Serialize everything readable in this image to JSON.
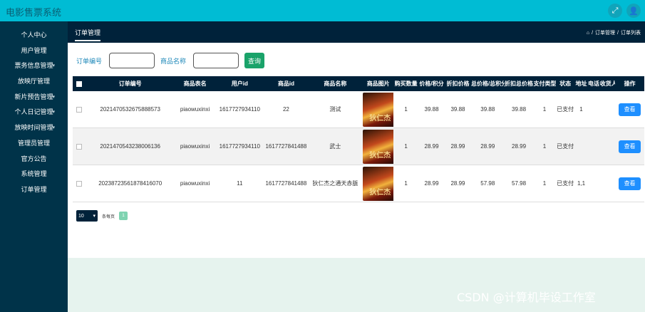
{
  "app": {
    "title": "电影售票系统"
  },
  "top_icons": [
    {
      "icon": "fullscreen-icon",
      "glyph": "⤢"
    },
    {
      "icon": "user-icon",
      "glyph": "👤"
    }
  ],
  "sidebar": {
    "items": [
      {
        "label": "个人中心",
        "has_caret": false
      },
      {
        "label": "用户管理",
        "has_caret": false
      },
      {
        "label": "票务信息管理",
        "has_caret": true
      },
      {
        "label": "放映厅管理",
        "has_caret": false
      },
      {
        "label": "新片预告管理",
        "has_caret": true
      },
      {
        "label": "个人日记管理",
        "has_caret": true
      },
      {
        "label": "放映时间管理",
        "has_caret": true
      },
      {
        "label": "管理员管理",
        "has_caret": false
      },
      {
        "label": "官方公告",
        "has_caret": false
      },
      {
        "label": "系统管理",
        "has_caret": false
      },
      {
        "label": "订单管理",
        "has_caret": false
      }
    ]
  },
  "header": {
    "tab": "订单管理",
    "breadcrumb": {
      "sep1": "/",
      "item1": "订单管理",
      "sep2": "/",
      "item2": "订单列表"
    }
  },
  "search": {
    "order_no_label": "订单编号",
    "product_name_label": "商品名称",
    "button": "查询"
  },
  "table": {
    "columns": [
      "订单编号",
      "商品表名",
      "用户id",
      "商品id",
      "商品名称",
      "商品图片",
      "购买数量",
      "价格/积分",
      "折扣价格",
      "总价格/总积分",
      "折扣总价格",
      "支付类型",
      "状态",
      "地址",
      "电话",
      "收货人",
      "操作"
    ],
    "rows": [
      {
        "order_no": "2021470532675888573",
        "table_name": "piaowuxinxi",
        "user_id": "1617727934110",
        "product_id": "22",
        "product_name": "测试",
        "poster_text": "狄仁杰",
        "qty": "1",
        "price": "39.88",
        "discount_price": "39.88",
        "total": "39.88",
        "discount_total": "39.88",
        "pay_type": "1",
        "status": "已支付",
        "address": "1",
        "phone": "",
        "receiver": "",
        "action": "查看"
      },
      {
        "order_no": "2021470543238006136",
        "table_name": "piaowuxinxi",
        "user_id": "1617727934110",
        "product_id": "1617727841488",
        "product_name": "武士",
        "poster_text": "狄仁杰",
        "qty": "1",
        "price": "28.99",
        "discount_price": "28.99",
        "total": "28.99",
        "discount_total": "28.99",
        "pay_type": "1",
        "status": "已支付",
        "address": "",
        "phone": "",
        "receiver": "",
        "action": "查看"
      },
      {
        "order_no": "20238723561878416070",
        "table_name": "piaowuxinxi",
        "user_id": "11",
        "product_id": "1617727841488",
        "product_name": "狄仁杰之通天赤脈",
        "poster_text": "狄仁杰",
        "qty": "1",
        "price": "28.99",
        "discount_price": "28.99",
        "total": "57.98",
        "discount_total": "57.98",
        "pay_type": "1",
        "status": "已支付",
        "address": "1,1",
        "phone": "",
        "receiver": "",
        "action": "查看"
      }
    ]
  },
  "pager": {
    "page_size": "10",
    "label": "条每页",
    "current_page": "1"
  },
  "watermark": "CSDN @计算机毕设工作室",
  "colors": {
    "topbar": "#00bcd4",
    "sidebar": "#003349",
    "header": "#00223a",
    "search_button": "#1aa36a",
    "view_button": "#1e8fff"
  }
}
